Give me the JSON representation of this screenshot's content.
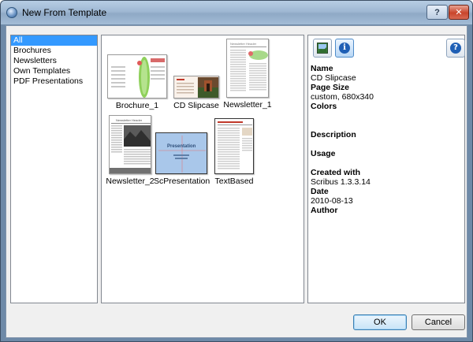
{
  "window": {
    "title": "New From Template",
    "help_label": "?",
    "close_label": "✕"
  },
  "categories": [
    {
      "label": "All",
      "selected": true
    },
    {
      "label": "Brochures",
      "selected": false
    },
    {
      "label": "Newsletters",
      "selected": false
    },
    {
      "label": "Own Templates",
      "selected": false
    },
    {
      "label": "PDF Presentations",
      "selected": false
    }
  ],
  "templates": [
    {
      "name": "Brochure_1",
      "thumbnail_heading": "",
      "selected": false
    },
    {
      "name": "CD Slipcase",
      "thumbnail_heading": "",
      "selected": true
    },
    {
      "name": "Newsletter_1",
      "thumbnail_heading": "Newsletter Header",
      "selected": false
    },
    {
      "name": "Newsletter_2",
      "thumbnail_heading": "Newsletter Header",
      "selected": false
    },
    {
      "name": "ScPresentation",
      "thumbnail_heading": "Presentation",
      "selected": false
    },
    {
      "name": "TextBased",
      "thumbnail_heading": "",
      "selected": false
    }
  ],
  "details": {
    "name_label": "Name",
    "name_value": "CD Slipcase",
    "page_size_label": "Page Size",
    "page_size_value": "custom, 680x340",
    "colors_label": "Colors",
    "colors_value": "",
    "description_label": "Description",
    "description_value": "",
    "usage_label": "Usage",
    "usage_value": "",
    "created_with_label": "Created with",
    "created_with_value": "Scribus 1.3.3.14",
    "date_label": "Date",
    "date_value": "2010-08-13",
    "author_label": "Author",
    "author_value": ""
  },
  "toolbar": {
    "info_glyph": "i",
    "help_glyph": "?"
  },
  "buttons": {
    "ok_label": "OK",
    "cancel_label": "Cancel"
  },
  "colors": {
    "selection": "#3399ff",
    "titlebar": "#9fb8d3",
    "close_button": "#c9442b"
  }
}
